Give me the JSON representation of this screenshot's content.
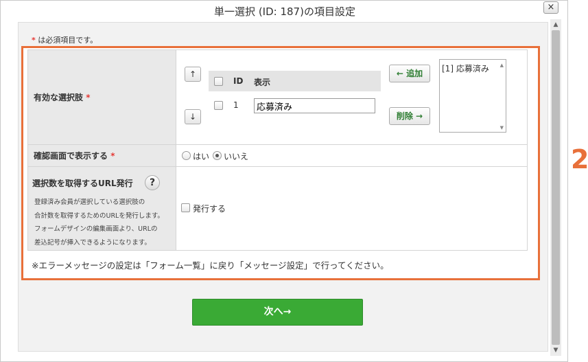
{
  "dialog": {
    "title": "単一選択 (ID: 187)の項目設定",
    "close_label": "×"
  },
  "required_note": {
    "star": "*",
    "text": " は必須項目です。"
  },
  "rows": {
    "options": {
      "label": "有効な選択肢",
      "star": "*",
      "up_label": "↑",
      "down_label": "↓",
      "columns": [
        "ID",
        "表示"
      ],
      "items": [
        {
          "id": "1",
          "display": "応募済み"
        }
      ],
      "add_label": "← 追加",
      "delete_label": "削除 →",
      "available": [
        "[1] 応募済み"
      ]
    },
    "confirm": {
      "label": "確認画面で表示する",
      "star": "*",
      "yes_label": "はい",
      "no_label": "いいえ",
      "selected": "いいえ"
    },
    "url": {
      "label": "選択数を取得するURL発行",
      "help": "?",
      "description": [
        "登録済み会員が選択している選択肢の",
        "合計数を取得するためのURLを発行します。",
        "フォームデザインの編集画面より、URLの",
        "差込記号が挿入できるようになります。"
      ],
      "checkbox_label": "発行する",
      "checked": false
    }
  },
  "footer_note": "※エラーメッセージの設定は「フォーム一覧」に戻り「メッセージ設定」で行ってください。",
  "next_button": "次へ→",
  "annotation": "2",
  "colors": {
    "highlight": "#e8703a",
    "next_button": "#3aaa35",
    "required": "#e53935",
    "action_text": "#2e7d32"
  }
}
